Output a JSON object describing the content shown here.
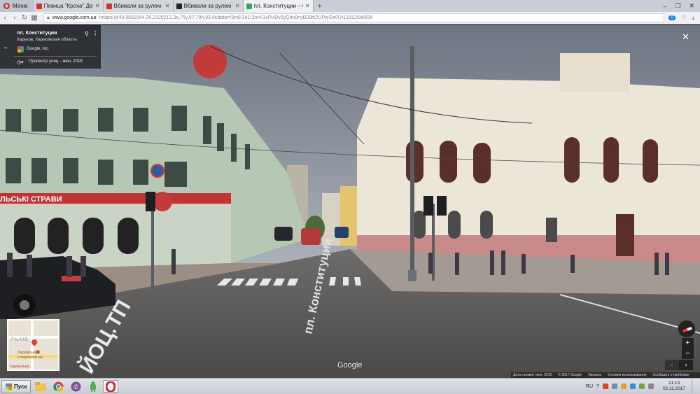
{
  "browser": {
    "menu_label": "Меню",
    "tabs": [
      {
        "title": "Певица \"Кроха\" День Креп",
        "active": false,
        "favicon_color": "#d93025"
      },
      {
        "title": "Вбивали за рулем посаш",
        "active": false,
        "favicon_color": "#d93025"
      },
      {
        "title": "Вбивали за рулем посаш",
        "active": false,
        "favicon_color": "#222222"
      },
      {
        "title": "пл. Конституции – Google",
        "active": true,
        "favicon_color": "#34a853"
      }
    ],
    "new_tab": "+",
    "address": {
      "domain": "www.google.com.ua",
      "path": "/maps/@49.9931554,36.2320213,3a,75y,97.79h,93.6t/data=!3m6!1e1!3m4!1sPHDv2yGftn0nyB28hl2UPw!2e0!7i13312!8i6656",
      "badge_count": "0"
    }
  },
  "info_card": {
    "title": "пл. Конституции",
    "subtitle": "Харьков, Харьковская область",
    "brand": "Google, Inc.",
    "capture": "Просмотр улиц – июн. 2015"
  },
  "scene": {
    "restaurant_sign": "ЛЬСЬКІ СТРАВИ",
    "street_marking": "пл. Конституции",
    "curb_marking": "ЙОЦ.ТП"
  },
  "minimap": {
    "city": "РЬКІВ",
    "poi": "Харківський історичний му",
    "street": "'ядельська"
  },
  "logo": "Google",
  "controls": {
    "zoom_in": "+",
    "zoom_out": "−",
    "prev": "‹",
    "next": "›"
  },
  "status": {
    "capture_date": "Дата съемки: июн. 2015",
    "copyright": "© 2017 Google",
    "country": "Украина",
    "terms": "Условия использования",
    "report": "Сообщить о проблеме"
  },
  "taskbar": {
    "start": "Пуск",
    "lang": "RU",
    "time": "21:13",
    "date": "02.11.2017"
  }
}
